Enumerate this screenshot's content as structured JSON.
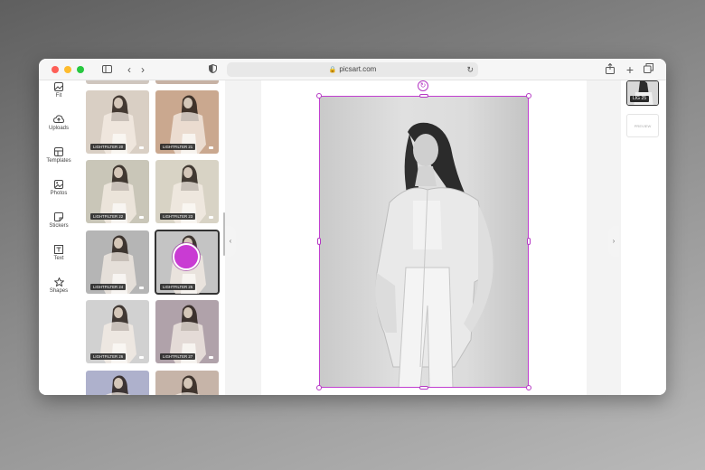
{
  "browser": {
    "url": "picsart.com"
  },
  "tools": [
    {
      "id": "fit",
      "label": "Fit"
    },
    {
      "id": "uploads",
      "label": "Uploads"
    },
    {
      "id": "templates",
      "label": "Templates"
    },
    {
      "id": "photos",
      "label": "Photos"
    },
    {
      "id": "stickers",
      "label": "Stickers"
    },
    {
      "id": "text",
      "label": "Text"
    },
    {
      "id": "shapes",
      "label": "Shapes"
    }
  ],
  "filters": [
    {
      "label": "LIGHTFILTER 20",
      "tone": "#d9cfc4"
    },
    {
      "label": "LIGHTFILTER 21",
      "tone": "#caa88f"
    },
    {
      "label": "LIGHTFILTER 22",
      "tone": "#c9c6b8"
    },
    {
      "label": "LIGHTFILTER 23",
      "tone": "#d8d3c5"
    },
    {
      "label": "LIGHTFILTER 24",
      "tone": "#b5b5b5"
    },
    {
      "label": "LIGHTFILTER 25",
      "tone": "#c4c4c4",
      "selected": true
    },
    {
      "label": "LIGHTFILTER 26",
      "tone": "#d1d1d1"
    },
    {
      "label": "LIGHTFILTER 27",
      "tone": "#b0a2aa"
    },
    {
      "label": "",
      "tone": "#aeb1cc"
    },
    {
      "label": "",
      "tone": "#c6b4a8"
    }
  ],
  "layers": {
    "active_label": "LIG 25",
    "placeholder": "PREVIEW"
  },
  "colors": {
    "selection": "#c13fd0",
    "cursor": "#c93bd3"
  }
}
